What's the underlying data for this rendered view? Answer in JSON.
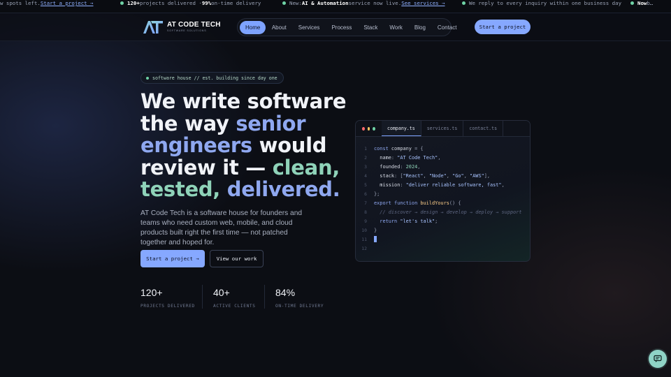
{
  "ticker": {
    "item1": {
      "text": "w spots left. ",
      "link": "Start a project →"
    },
    "item2": {
      "bold1": "120+",
      "text1": " projects delivered · ",
      "bold2": "99%",
      "text2": " on-time delivery"
    },
    "item3": {
      "prefix": "New: ",
      "bold": "AI & Automation",
      "text": " service now live. ",
      "link": "See services →"
    },
    "item4": {
      "text": "We reply to every inquiry within one business day"
    },
    "item5": {
      "bold": "Now",
      "text": " b…"
    }
  },
  "header": {
    "logo_name": "AT CODE TECH",
    "logo_tagline": "SOFTWARE SOLUTIONS",
    "nav": [
      "Home",
      "About",
      "Services",
      "Process",
      "Stack",
      "Work",
      "Blog",
      "Contact"
    ],
    "cta": "Start a project"
  },
  "hero": {
    "pill": "software house // est. building since day one",
    "headline": {
      "w1": "We write software",
      "w2": "the way ",
      "w3": "senior",
      "w4": "engineers",
      "w5": " would",
      "w6": "review it — ",
      "w7": "clean,",
      "w8": "tested,",
      "w9": " delivered."
    },
    "lede": "AT Code Tech is a software house for founders and teams who need custom web, mobile, and cloud products built right the first time — not patched together and hoped for.",
    "primary_cta": "Start a project →",
    "secondary_cta": "View our work"
  },
  "stats": [
    {
      "value": "120+",
      "label": "PROJECTS DELIVERED"
    },
    {
      "value": "40+",
      "label": "ACTIVE CLIENTS"
    },
    {
      "value": "84%",
      "label": "ON-TIME DELIVERY"
    }
  ],
  "code": {
    "tabs": [
      "company.ts",
      "services.ts",
      "contact.ts"
    ],
    "line_numbers": [
      "1",
      "2",
      "3",
      "4",
      "5",
      "6",
      "7",
      "8",
      "9",
      "10",
      "11",
      "12"
    ],
    "l1": {
      "kw": "const",
      "id": " company",
      "p": " = {"
    },
    "l2": {
      "key": "  name",
      "p": ": ",
      "str": "\"AT Code Tech\"",
      "p2": ","
    },
    "l3": {
      "key": "  founded",
      "p": ": ",
      "num": "2024",
      "p2": ","
    },
    "l4": {
      "key": "  stack",
      "p": ": [",
      "s1": "\"React\"",
      "c1": ", ",
      "s2": "\"Node\"",
      "c2": ", ",
      "s3": "\"Go\"",
      "c3": ", ",
      "s4": "\"AWS\"",
      "p2": "],"
    },
    "l5": {
      "key": "  mission",
      "p": ": ",
      "str": "\"deliver reliable software, fast\"",
      "p2": ","
    },
    "l6": {
      "p": "};"
    },
    "l7": {
      "kw": "export function",
      "fn": " buildYours",
      "p": "() {"
    },
    "l8": {
      "cm": "  // discover → design → develop → deploy → support"
    },
    "l9": {
      "kw": "  return",
      "str": " \"let's talk\"",
      "p": ";"
    },
    "l10": {
      "p": "}"
    }
  },
  "colors": {
    "accent": "#86a8ff",
    "green": "#8fd3b9",
    "background": "#0c0e14"
  }
}
